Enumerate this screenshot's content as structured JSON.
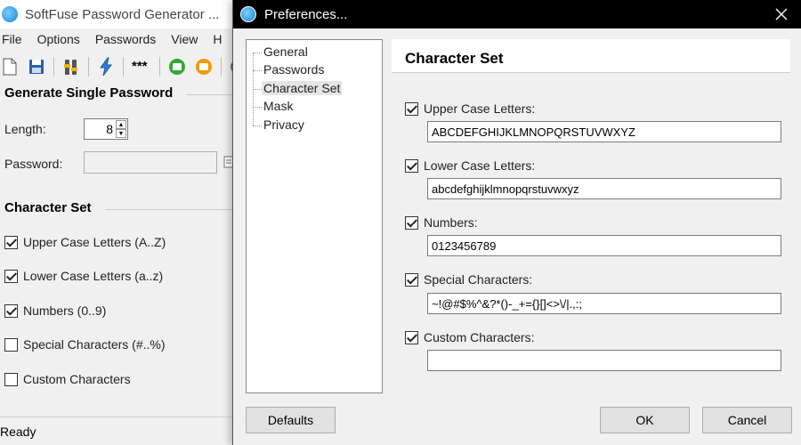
{
  "main_window": {
    "title": "SoftFuse Password Generator ...",
    "menu": [
      "File",
      "Options",
      "Passwords",
      "View",
      "H"
    ],
    "toolbar_icons": [
      "new-doc-icon",
      "save-icon",
      "settings-icon",
      "lightning-icon",
      "mask-icon",
      "green-db-icon",
      "orange-db-icon",
      "globe-icon"
    ],
    "mask_label": "***",
    "generate_heading": "Generate Single Password",
    "length_label": "Length:",
    "length_value": "8",
    "password_label": "Password:",
    "password_value": "",
    "charset_heading": "Character Set",
    "charset_options": [
      {
        "label": "Upper Case Letters (A..Z)",
        "checked": true
      },
      {
        "label": "Lower Case Letters (a..z)",
        "checked": true
      },
      {
        "label": "Numbers (0..9)",
        "checked": true
      },
      {
        "label": "Special Characters (#..%)",
        "checked": false
      },
      {
        "label": "Custom Characters",
        "checked": false
      }
    ],
    "status": "Ready"
  },
  "dialog": {
    "title": "Preferences...",
    "tree_items": [
      {
        "label": "General",
        "selected": false
      },
      {
        "label": "Passwords",
        "selected": false
      },
      {
        "label": "Character Set",
        "selected": true
      },
      {
        "label": "Mask",
        "selected": false
      },
      {
        "label": "Privacy",
        "selected": false
      }
    ],
    "panel_title": "Character Set",
    "fields": [
      {
        "label": "Upper Case Letters:",
        "checked": true,
        "value": "ABCDEFGHIJKLMNOPQRSTUVWXYZ"
      },
      {
        "label": "Lower Case Letters:",
        "checked": true,
        "value": "abcdefghijklmnopqrstuvwxyz"
      },
      {
        "label": "Numbers:",
        "checked": true,
        "value": "0123456789"
      },
      {
        "label": "Special Characters:",
        "checked": true,
        "value": "~!@#$%^&?*()-_+={}[]<>\\/|.,:;"
      },
      {
        "label": "Custom Characters:",
        "checked": true,
        "value": ""
      }
    ],
    "buttons": {
      "defaults": "Defaults",
      "ok": "OK",
      "cancel": "Cancel"
    }
  }
}
